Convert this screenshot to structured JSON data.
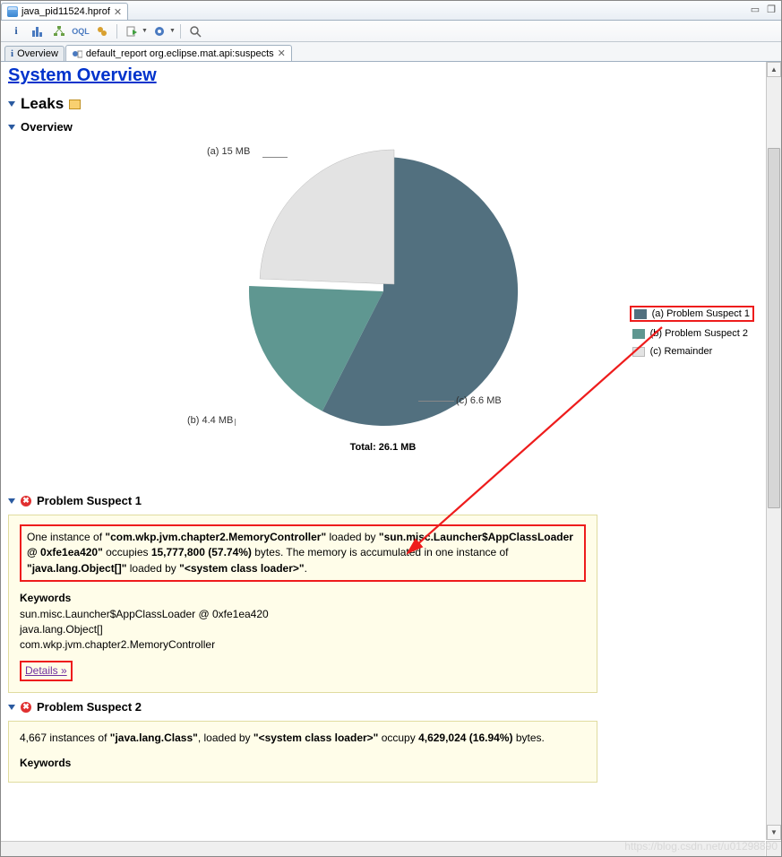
{
  "tab": {
    "title": "java_pid11524.hprof"
  },
  "inner_tabs": {
    "overview": "Overview",
    "report": "default_report  org.eclipse.mat.api:suspects"
  },
  "headings": {
    "system_overview": "System Overview",
    "leaks": "Leaks",
    "overview": "Overview",
    "suspect1": "Problem Suspect 1",
    "suspect2": "Problem Suspect 2"
  },
  "chart_data": {
    "type": "pie",
    "title": "Total: 26.1 MB",
    "series": [
      {
        "name": "(a) Problem Suspect 1",
        "label": "(a)  15 MB",
        "value": 15.0,
        "color": "#52707f"
      },
      {
        "name": "(b) Problem Suspect 2",
        "label": "(b)  4.4 MB",
        "value": 4.4,
        "color": "#5f9791"
      },
      {
        "name": "(c) Remainder",
        "label": "(c)  6.6 MB",
        "value": 6.6,
        "color": "#e3e3e3"
      }
    ]
  },
  "suspect1": {
    "text_pre": "One instance of ",
    "class": "\"com.wkp.jvm.chapter2.MemoryController\"",
    "text_loaded": " loaded by ",
    "loader": "\"sun.misc.Launcher$AppClassLoader @ 0xfe1ea420\"",
    "text_occ": " occupies ",
    "bytes": "15,777,800 (57.74%)",
    "text_bytes_suffix": " bytes. The memory is accumulated in one instance of ",
    "acc_class": "\"java.lang.Object[]\"",
    "text_loaded2": " loaded by ",
    "loader2": "\"<system class loader>\"",
    "period": ".",
    "kw_title": "Keywords",
    "kw1": "sun.misc.Launcher$AppClassLoader @ 0xfe1ea420",
    "kw2": "java.lang.Object[]",
    "kw3": "com.wkp.jvm.chapter2.MemoryController",
    "details": "Details »"
  },
  "suspect2": {
    "count": "4,667",
    "text_inst": " instances of ",
    "class": "\"java.lang.Class\"",
    "text_loaded": ", loaded by ",
    "loader": "\"<system class loader>\"",
    "text_occ": " occupy ",
    "bytes": "4,629,024 (16.94%)",
    "text_suffix": " bytes.",
    "kw_title": "Keywords"
  },
  "watermark": "https://blog.csdn.net/u01298890"
}
